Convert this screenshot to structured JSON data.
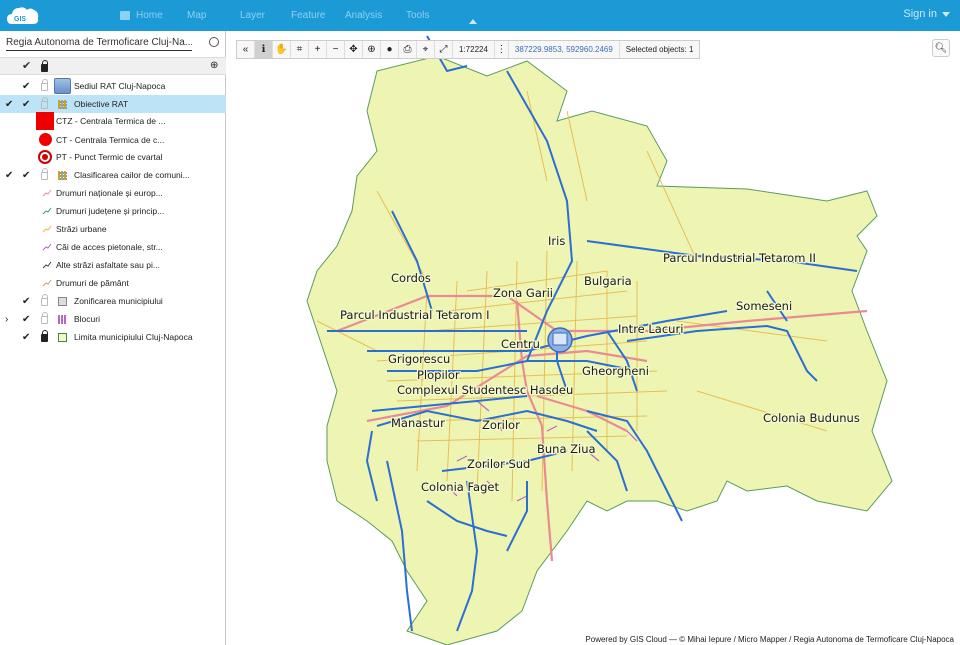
{
  "header": {
    "nav": [
      "Home",
      "Map",
      "Layer",
      "Feature",
      "Analysis",
      "Tools"
    ],
    "sign_in": "Sign in"
  },
  "sidebar": {
    "project_title": "Regia Autonoma de Termoficare Cluj-Na...",
    "layers": [
      {
        "label": "Sediul RAT Cluj-Napoca"
      },
      {
        "label": "Obiective RAT"
      },
      {
        "label": "CTZ - Centrala Termica de ..."
      },
      {
        "label": "CT - Centrala Termica de c..."
      },
      {
        "label": "PT - Punct Termic de cvartal"
      },
      {
        "label": "Clasificarea cailor de comuni..."
      },
      {
        "label": "Drumuri naționale și europ..."
      },
      {
        "label": "Drumuri județene și princip..."
      },
      {
        "label": "Străzi urbane"
      },
      {
        "label": "Căi de acces pietonale, str..."
      },
      {
        "label": "Alte străzi asfaltate sau pi..."
      },
      {
        "label": "Drumuri de pământ"
      },
      {
        "label": "Zonificarea municipiului"
      },
      {
        "label": "Blocuri"
      },
      {
        "label": "Limita municipiului Cluj-Napoca"
      }
    ]
  },
  "toolbar": {
    "scale": "1:72224",
    "coordinates": "387229.9853, 592960.2469",
    "selected": "Selected objects: 1"
  },
  "map_labels": {
    "iris": "Iris",
    "tetarom2": "Parcul Industrial Tetarom II",
    "cordos": "Cordos",
    "zona_gari": "Zona Garii",
    "bulgaria": "Bulgaria",
    "someseni": "Someseni",
    "tetarom1": "Parcul Industrial Tetarom I",
    "intre_lacuri": "Intre Lacuri",
    "centru": "Centru",
    "grigorescu": "Grigorescu",
    "gheorgheni": "Gheorgheni",
    "plopilor": "Plopilor",
    "hasdeu": "Complexul Studentesc Hasdeu",
    "budunus": "Colonia Budunus",
    "manastur": "Manastur",
    "zorilor": "Zorilor",
    "buna_ziua": "Buna Ziua",
    "zorilor_sud": "Zorilor Sud",
    "faget": "Colonia Faget"
  },
  "credit": "Powered by GIS Cloud — © Mihai Iepure / Micro Mapper / Regia Autonoma de Termoficare Cluj-Napoca",
  "colors": {
    "topbar": "#1b9ad6",
    "map_fill": "#eef5b3",
    "rivers": "#2a6fd1",
    "roads_major": "#e98a94",
    "roads_minor": "#e8b84a"
  }
}
